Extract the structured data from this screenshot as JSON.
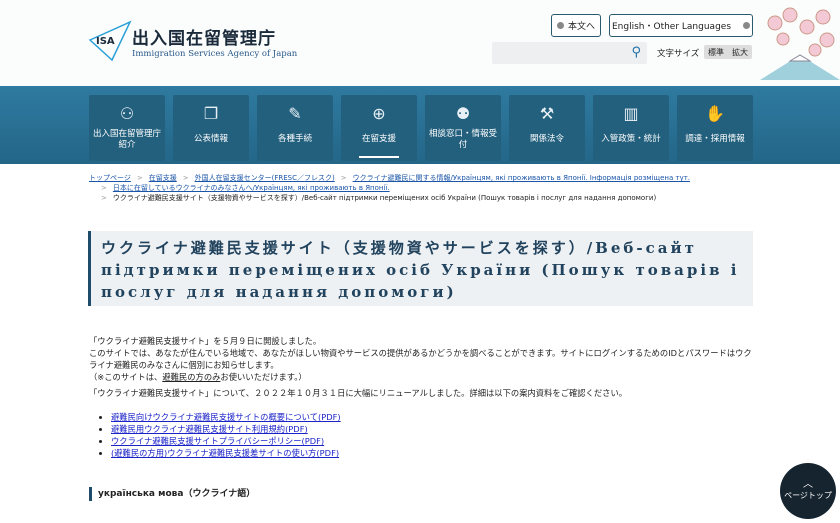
{
  "header": {
    "logo_abbr": "ISA",
    "logo_title": "出入国在留管理庁",
    "logo_subtitle": "Immigration Services Agency of Japan",
    "skip_button": "本文へ",
    "language_button": "English・Other Languages",
    "search_placeholder": "",
    "font_size_label": "文字サイズ",
    "font_size_standard": "標準",
    "font_size_large": "拡大"
  },
  "nav": [
    {
      "label": "出入国在留管理庁紹介",
      "icon": "people-network-icon"
    },
    {
      "label": "公表情報",
      "icon": "documents-icon"
    },
    {
      "label": "各種手続",
      "icon": "form-pen-icon"
    },
    {
      "label": "在留支援",
      "icon": "globe-hand-icon",
      "active": true
    },
    {
      "label": "相談窓口・情報受付",
      "icon": "consultation-icon"
    },
    {
      "label": "関係法令",
      "icon": "gavel-icon"
    },
    {
      "label": "入管政策・統計",
      "icon": "chart-icon"
    },
    {
      "label": "調達・採用情報",
      "icon": "handshake-icon"
    }
  ],
  "breadcrumb": {
    "items": [
      "トップページ",
      "在留支援",
      "外国人在留支援センター(FRESC／フレスク)",
      "ウクライナ避難民に関する情報/Українцям, які проживають в Японії. Інформація розміщена тут.",
      "日本に在留しているウクライナのみなさんへ/Українцям, які проживають в Японії."
    ],
    "current": "ウクライナ避難民支援サイト（支援物資やサービスを探す）/Веб-сайт підтримки переміщених осіб України (Пошук товарів і послуг для надання допомоги)"
  },
  "page_title": "ウクライナ避難民支援サイト（支援物資やサービスを探す）/Веб-сайт підтримки переміщених осіб України (Пошук товарів і послуг для надання допомоги)",
  "body": {
    "p1": "「ウクライナ避難民支援サイト」を５月９日に開設しました。",
    "p2": "このサイトでは、あなたが住んでいる地域で、あなたがほしい物資やサービスの提供があるかどうかを調べることができます。サイトにログインするためのIDとパスワードはウクライナ避難民のみなさんに個別にお知らせします。",
    "p3_pre": "（※このサイトは、",
    "p3_u": "避難民の方のみ",
    "p3_post": "お使いいただけます。）",
    "p4": "「ウクライナ避難民支援サイト」について、２０２２年１０月３１日に大幅にリニューアルしました。詳細は以下の案内資料をご確認ください。",
    "links": [
      "避難民向けウクライナ避難民支援サイトの概要について(PDF)",
      "避難民用ウクライナ避難民支援サイト利用規約(PDF)",
      "ウクライナ避難民支援サイトプライバシーポリシー(PDF)",
      "(避難民の方用)ウクライナ避難民支援差サイトの使い方(PDF)"
    ]
  },
  "section_heading": "українська мова（ウクライナ語）",
  "page_top": "ページトップ"
}
